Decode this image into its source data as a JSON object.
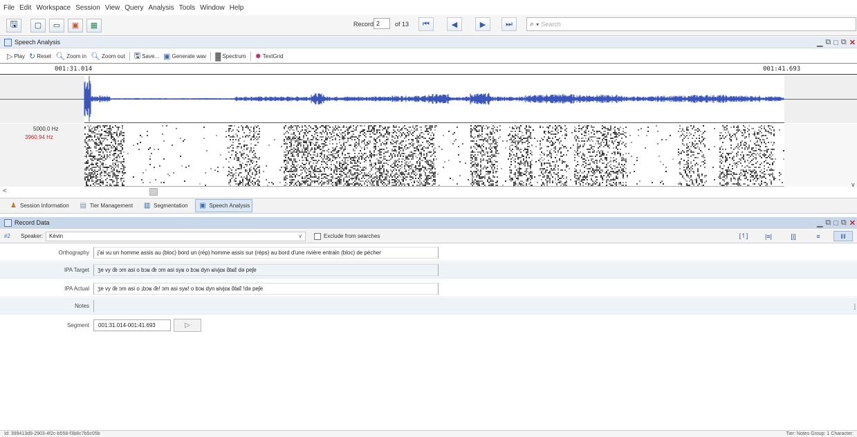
{
  "menu": [
    "File",
    "Edit",
    "Workspace",
    "Session",
    "View",
    "Query",
    "Analysis",
    "Tools",
    "Window",
    "Help"
  ],
  "toolbar": {
    "record_label": "Record:",
    "record_value": "2",
    "record_of": "of 13",
    "search_placeholder": "Search"
  },
  "speech_panel": {
    "title": "Speech Analysis",
    "tools": {
      "play": "Play",
      "reset": "Reset",
      "zoom_in": "Zoom in",
      "zoom_out": "Zoom out",
      "save": "Save...",
      "generate_wav": "Generate wav",
      "spectrum": "Spectrum",
      "textgrid": "TextGrid"
    },
    "time_start": "001:31.014",
    "time_end": "001:41.693",
    "freq_max": "5000.0 Hz",
    "freq_cursor": "3960.94 Hz"
  },
  "bottom_tabs": [
    {
      "label": "Session Information",
      "active": false
    },
    {
      "label": "Tier Management",
      "active": false
    },
    {
      "label": "Segmentation",
      "active": false
    },
    {
      "label": "Speech Analysis",
      "active": true
    }
  ],
  "record_data": {
    "title": "Record Data",
    "record_number": "2",
    "speaker_label": "Speaker:",
    "speaker_value": "Kévin",
    "exclude_label": "Exclude from searches",
    "tiers": [
      {
        "name": "Orthography",
        "value": "j'ai vu un homme assis au (bloc) bord un (rép) homme assis sur (réps) au bord d'une rivière entrain (bloc) de pécher"
      },
      {
        "name": "IPA Target",
        "value": "ʒe vy œ̃ ɔm asi o bɔʁ œ̃ ɔm asi syʁ o bɔʁ dyn ʁivjɛʁ ɑ̃tʁɛ̃ də peʃe"
      },
      {
        "name": "IPA Actual",
        "value": "ʒe vy œ̃ ɔm asi o ¡bɔʁ œ̃! ɔm asi syʁ! o bɔʁ dyn ʁivjɛʁ ɑ̃tʁɛ̃ !də peʃe"
      },
      {
        "name": "Notes",
        "value": ""
      }
    ],
    "segment_label": "Segment",
    "segment_value": "001:31.014-001:41.693"
  },
  "status": {
    "left": "Id: 399413d9-2903-4f2c-b558-f3b8c7b5c05b",
    "right": "Tier: Notes Group: 1 Character:"
  },
  "colors": {
    "waveform": "#3b55b8",
    "panel_header": "#e6ecf3",
    "record_header": "#c9d7ea",
    "close_red": "#d21f1f",
    "cursor_freq": "#d02020"
  }
}
